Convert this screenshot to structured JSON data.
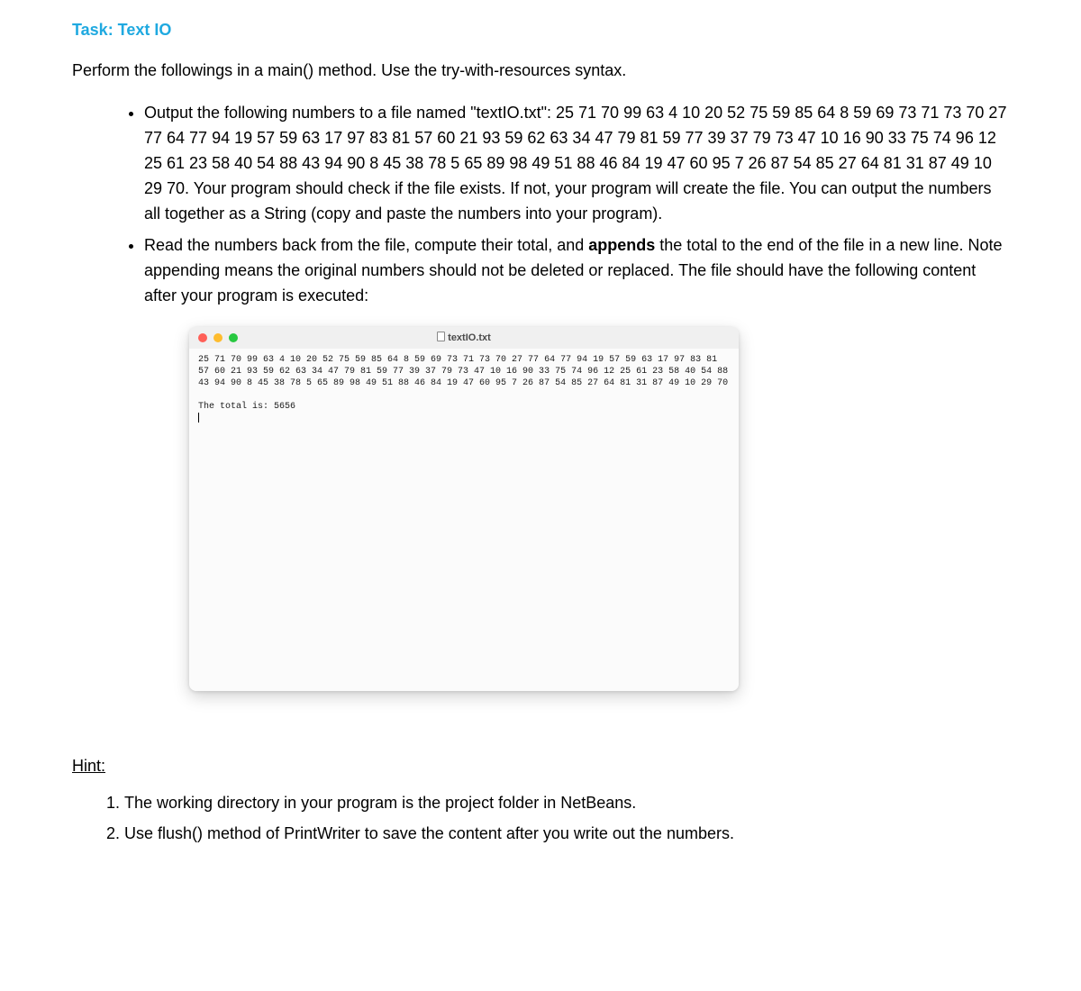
{
  "task_title": "Task: Text IO",
  "intro": "Perform the followings in a main() method. Use the try-with-resources syntax.",
  "bullets": [
    {
      "pre": "Output the following numbers to a file named \"textIO.txt\": 25 71 70 99 63 4 10 20 52 75 59 85 64 8 59 69 73 71 73 70 27 77 64 77 94 19 57 59 63 17 97 83 81 57 60 21 93 59 62 63 34 47 79 81 59 77 39 37 79 73 47 10 16 90 33 75 74 96 12 25 61 23 58 40 54 88 43 94 90 8 45 38 78 5 65 89 98 49 51 88 46 84 19 47 60 95 7 26 87 54 85 27 64 81 31 87 49 10 29 70. Your program should check if the file exists. If not, your program will create the file. You can output the numbers all together as a String (copy and paste the numbers into your program).",
      "bold": "",
      "post": ""
    },
    {
      "pre": "Read the numbers back from the file, compute their total, and ",
      "bold": "appends",
      "post": " the total to the end of the file in a new line. Note appending means the original numbers should not be deleted or replaced. The file should have the following content after your program is executed:"
    }
  ],
  "terminal": {
    "filename": "textIO.txt",
    "content_numbers": "25 71 70 99 63 4 10 20 52 75 59 85 64 8 59 69 73 71 73 70 27 77 64 77 94 19 57 59 63 17 97 83 81 57 60 21 93 59 62 63 34 47 79 81 59 77 39 37 79 73 47 10 16 90 33 75 74 96 12 25 61 23 58 40 54 88 43 94 90 8 45 38 78 5 65 89 98 49 51 88 46 84 19 47 60 95 7 26 87 54 85 27 64 81 31 87 49 10 29 70",
    "total_line": "The total is: 5656"
  },
  "hint_title": "Hint:",
  "hints": [
    "The working directory in your program is the project folder in NetBeans.",
    "Use flush() method of PrintWriter to save the content after you write out the numbers."
  ]
}
